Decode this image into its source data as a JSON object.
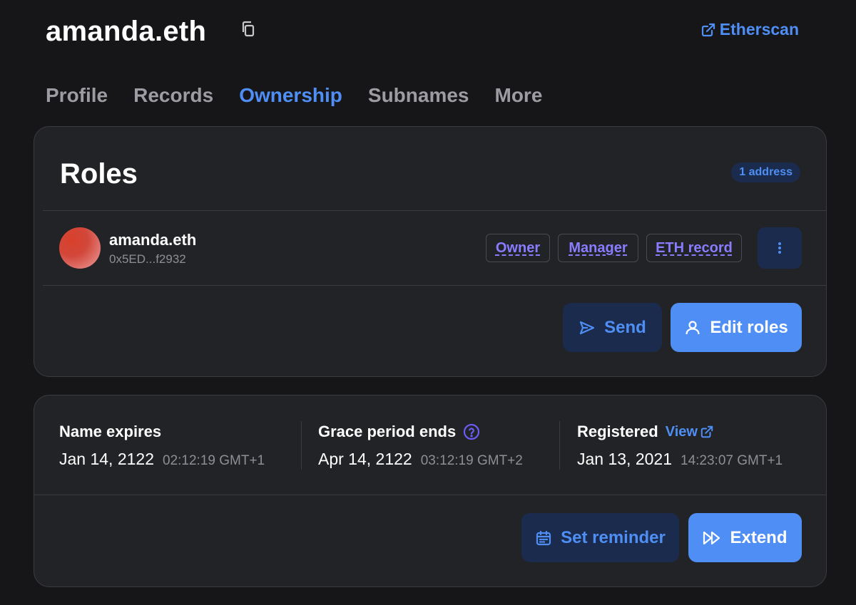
{
  "header": {
    "name": "amanda.eth",
    "copy_icon": "copy-icon",
    "etherscan_label": "Etherscan",
    "etherscan_icon": "external-link-icon"
  },
  "tabs": [
    {
      "label": "Profile",
      "active": false
    },
    {
      "label": "Records",
      "active": false
    },
    {
      "label": "Ownership",
      "active": true
    },
    {
      "label": "Subnames",
      "active": false
    },
    {
      "label": "More",
      "active": false
    }
  ],
  "roles": {
    "title": "Roles",
    "badge": "1 address",
    "user": {
      "name": "amanda.eth",
      "address": "0x5ED...f2932"
    },
    "tags": [
      "Owner",
      "Manager",
      "ETH record"
    ],
    "send_label": "Send",
    "edit_label": "Edit roles"
  },
  "dates": {
    "expires": {
      "label": "Name expires",
      "date": "Jan 14, 2122",
      "time": "02:12:19 GMT+1"
    },
    "grace": {
      "label": "Grace period ends",
      "date": "Apr 14, 2122",
      "time": "03:12:19 GMT+2"
    },
    "registered": {
      "label": "Registered",
      "view_label": "View",
      "date": "Jan 13, 2021",
      "time": "14:23:07 GMT+1"
    },
    "reminder_label": "Set reminder",
    "extend_label": "Extend"
  },
  "colors": {
    "accent": "#4f8ff5",
    "role_tag": "#8a7cff",
    "background": "#161618",
    "card": "#222326"
  }
}
